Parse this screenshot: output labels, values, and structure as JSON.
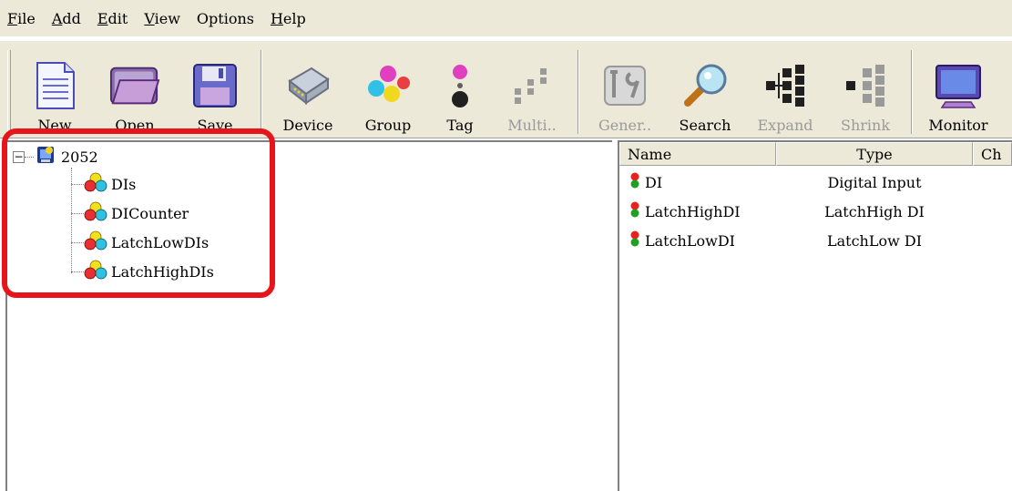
{
  "menu": {
    "items": [
      {
        "label": "File",
        "u": "F",
        "rest": "ile"
      },
      {
        "label": "Add",
        "u": "A",
        "rest": "dd"
      },
      {
        "label": "Edit",
        "u": "E",
        "rest": "dit"
      },
      {
        "label": "View",
        "u": "V",
        "rest": "iew"
      },
      {
        "label": "Options",
        "u": "",
        "rest": "Options"
      },
      {
        "label": "Help",
        "u": "H",
        "rest": "elp"
      }
    ]
  },
  "toolbar": {
    "new": "New",
    "open": "Open",
    "save": "Save",
    "device": "Device",
    "group": "Group",
    "tag": "Tag",
    "multi": "Multi..",
    "gener": "Gener..",
    "search": "Search",
    "expand": "Expand",
    "shrink": "Shrink",
    "monitor": "Monitor"
  },
  "tree": {
    "root": "2052",
    "children": [
      "DIs",
      "DICounter",
      "LatchLowDIs",
      "LatchHighDIs"
    ]
  },
  "list": {
    "columns": [
      "Name",
      "Type",
      "Ch"
    ],
    "rows": [
      {
        "name": "DI",
        "type": "Digital Input"
      },
      {
        "name": "LatchHighDI",
        "type": "LatchHigh DI"
      },
      {
        "name": "LatchLowDI",
        "type": "LatchLow DI"
      }
    ]
  },
  "colors": {
    "highlight": "#e8141b",
    "chrome": "#ece9d8"
  }
}
